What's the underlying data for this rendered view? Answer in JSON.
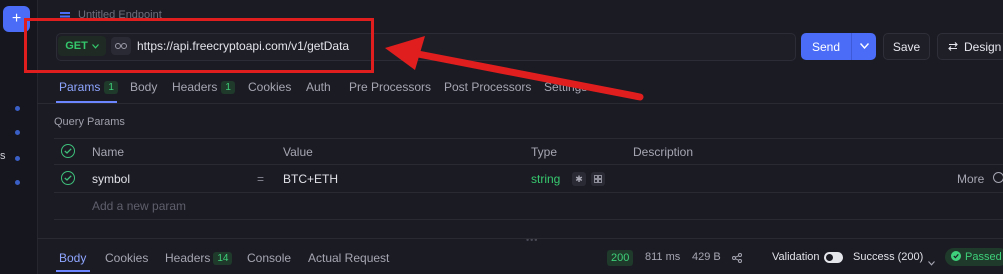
{
  "rail": {
    "plus_label": "+",
    "partial_label": "s"
  },
  "endpoint": {
    "title": "Untitled Endpoint"
  },
  "request": {
    "method": "GET",
    "url": "https://api.freecryptoapi.com/v1/getData",
    "send_label": "Send",
    "save_label": "Save",
    "design_label": "Design"
  },
  "tabs": [
    {
      "label": "Params",
      "badge": "1"
    },
    {
      "label": "Body"
    },
    {
      "label": "Headers",
      "badge": "1"
    },
    {
      "label": "Cookies"
    },
    {
      "label": "Auth"
    },
    {
      "label": "Pre Processors"
    },
    {
      "label": "Post Processors"
    },
    {
      "label": "Settings"
    }
  ],
  "query_params": {
    "title": "Query Params",
    "columns": [
      "Name",
      "Value",
      "Type",
      "Description"
    ],
    "rows": [
      {
        "name": "symbol",
        "eq": "=",
        "value": "BTC+ETH",
        "type": "string",
        "more": "More"
      }
    ],
    "add_placeholder": "Add a new param"
  },
  "bottom": {
    "tabs": [
      {
        "label": "Body"
      },
      {
        "label": "Cookies"
      },
      {
        "label": "Headers",
        "badge": "14"
      },
      {
        "label": "Console"
      },
      {
        "label": "Actual Request"
      }
    ],
    "status_code": "200",
    "time": "811 ms",
    "size": "429 B",
    "validation_label": "Validation",
    "success_label": "Success (200)",
    "passed_label": "Passed"
  },
  "icons": {
    "method_caret": "chevron-down-icon",
    "link": "link-icon",
    "send_caret": "chevron-down-icon",
    "design": "arrows-icon",
    "check": "check-circle-icon",
    "share": "share-icon"
  },
  "colors": {
    "accent": "#4a6cf7",
    "success": "#34c76b",
    "annotation": "#e01e1e"
  }
}
